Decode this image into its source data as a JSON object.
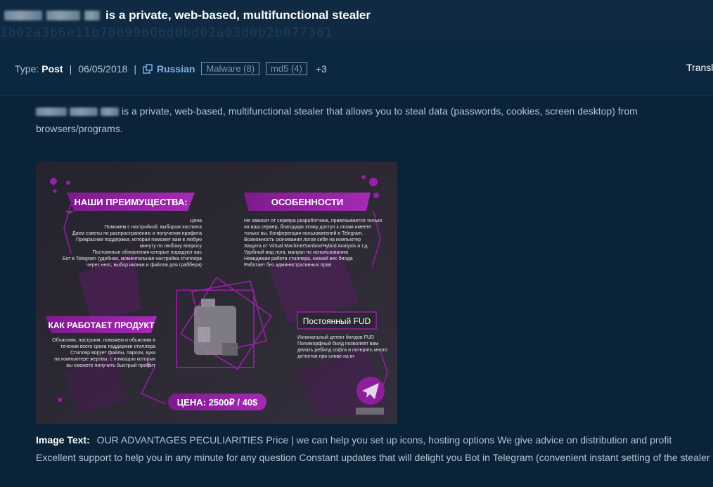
{
  "header": {
    "title": "is a private, web-based, multifunctional stealer",
    "ghost_text": "1b02a3b6e11b70899b0bd0bd02a03d0b2b077361"
  },
  "meta": {
    "type_label": "Type:",
    "type_value": "Post",
    "separator": "|",
    "date": "06/05/2018",
    "language_icon": "external-link-icon",
    "language": "Russian",
    "tags": [
      "Malware (8)",
      "md5 (4)"
    ],
    "more": "+3",
    "translate": "Transl"
  },
  "description": "is a private, web-based, multifunctional stealer that allows you to steal data (passwords, cookies, screen desktop) from browsers/programs.",
  "promo_image": {
    "heading_advantages": "НАШИ ПРЕИМУЩЕСТВА:",
    "heading_features": "ОСОБЕННОСТИ",
    "heading_how": "КАК РАБОТАЕТ ПРОДУКТ",
    "heading_fud": "Постоянный FUD",
    "price": "ЦЕНА: 2500₽ / 40$",
    "advantages_lines": [
      "Цена",
      "Поможем с настройкой, выбором хостинга",
      "Даем советы по распространению и получения профита",
      "Прекрасная поддержка, которая поможет вам в любую",
      "минуту по любому вопросу",
      "Постоянные обновления которые порадуют вас",
      "Бот в Telegram (удобная, моментальная настройка стиллера",
      "через него, выбор иконки и файлов для граббера)"
    ],
    "features_lines": [
      "Не зависит от сервера разработчика, привязывается только",
      "на ваш сервер, благодаря этому доступ к логам имеете",
      "только вы. Конференция пользователей в Telegram.",
      "Возможность скачивания логов себе на компьютер",
      "Защита от Virtual Machine/Sanbox/Hybrid Analysis и т.д.",
      "Удобный вид лога, мануал по использованию",
      "Невидимая работа стиллера, низкий вес билда",
      "Работает без административных прав"
    ],
    "how_lines": [
      "Объясним, настроим, поможем и обьясним в",
      "течении всего срока поддержки стиллера",
      "Стиллер ворует файлы, пароли, куки",
      "на компьютере жертвы, с помощью которых",
      "вы сможете получить быстрый профит"
    ],
    "fud_lines": [
      "Изначальный детект билдов FUD",
      "Полиморфный билд позволяет вам",
      "делать ребилд софта и потерять много",
      "детектов при сливе на вт"
    ],
    "telegram_icon": "telegram-icon"
  },
  "image_text": {
    "label": "Image Text:",
    "value": "OUR ADVANTAGES PECULIARITIES Price | we can help you set up icons, hosting options We give advice on distribution and profit Excellent support to help you in any minute for any question Constant updates that will delight you Bot in Telegram (convenient instant setting of the stealer"
  },
  "colors": {
    "background": "#0b2338",
    "header": "#0f2a42",
    "accent": "#7fb3e3",
    "promo_purple": "#9b1fa8"
  }
}
